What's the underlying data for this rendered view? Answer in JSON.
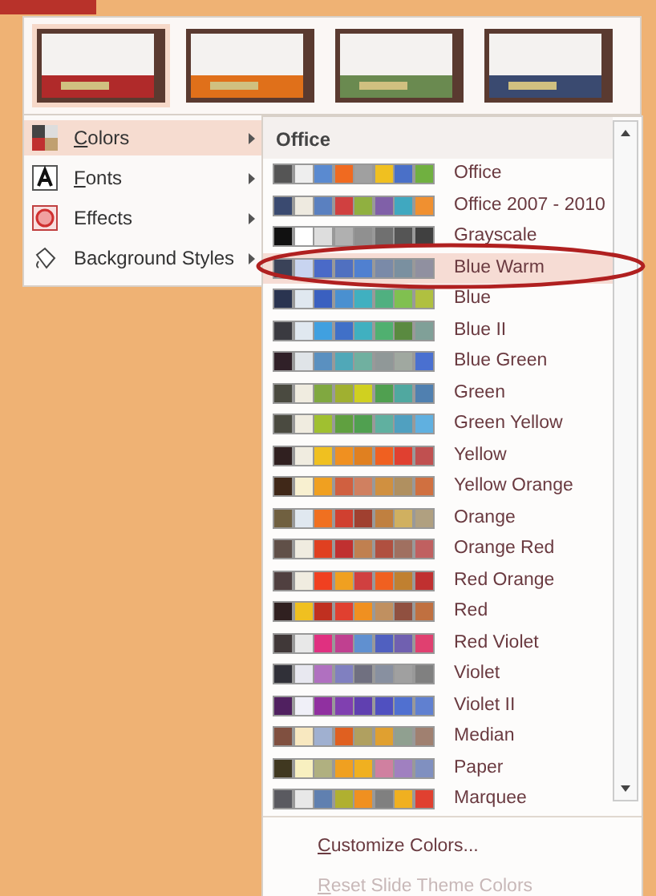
{
  "themes": [
    {
      "color": "#b02a2a",
      "selected": true
    },
    {
      "color": "#e0701a",
      "selected": false
    },
    {
      "color": "#6a8a50",
      "selected": false
    },
    {
      "color": "#3a4a70",
      "selected": false
    }
  ],
  "menu": [
    {
      "label": "Colors",
      "mnemonic": true,
      "selected": true,
      "kind": "colors"
    },
    {
      "label": "Fonts",
      "mnemonic": true,
      "selected": false,
      "kind": "fonts"
    },
    {
      "label": "Effects",
      "mnemonic": false,
      "selected": false,
      "kind": "effects"
    },
    {
      "label": "Background Styles",
      "mnemonic": false,
      "selected": false,
      "kind": "background"
    }
  ],
  "submenu": {
    "header": "Office",
    "items": [
      {
        "label": "Office",
        "selected": false,
        "swatches": [
          {
            "color": "#555555"
          },
          {
            "color": "#eeeeee"
          },
          {
            "color": "#5a8ad0"
          },
          {
            "color": "#f06a20"
          },
          {
            "color": "#a0a0a0"
          },
          {
            "color": "#f0c020"
          },
          {
            "color": "#4a70c8"
          },
          {
            "color": "#70b040"
          }
        ]
      },
      {
        "label": "Office 2007 - 2010",
        "selected": false,
        "swatches": [
          {
            "color": "#3a4a70"
          },
          {
            "color": "#eeeae0"
          },
          {
            "color": "#5a80c0"
          },
          {
            "color": "#d04040"
          },
          {
            "color": "#90b040"
          },
          {
            "color": "#8060a8"
          },
          {
            "color": "#40a8c0"
          },
          {
            "color": "#f09030"
          }
        ]
      },
      {
        "label": "Grayscale",
        "selected": false,
        "swatches": [
          {
            "color": "#111111"
          },
          {
            "color": "#ffffff"
          },
          {
            "color": "#dddddd"
          },
          {
            "color": "#b0b0b0"
          },
          {
            "color": "#909090"
          },
          {
            "color": "#707070"
          },
          {
            "color": "#555555"
          },
          {
            "color": "#404040"
          }
        ]
      },
      {
        "label": "Blue Warm",
        "selected": true,
        "swatches": [
          {
            "color": "#3a4258"
          },
          {
            "color": "#c8d4f0"
          },
          {
            "color": "#4a6ac8"
          },
          {
            "color": "#5070c0"
          },
          {
            "color": "#5080d0"
          },
          {
            "color": "#7a8aa8"
          },
          {
            "color": "#7a90a0"
          },
          {
            "color": "#9090a0"
          }
        ]
      },
      {
        "label": "Blue",
        "selected": false,
        "swatches": [
          {
            "color": "#2a3450"
          },
          {
            "color": "#e0e8f0"
          },
          {
            "color": "#3a60c0"
          },
          {
            "color": "#4a90d0"
          },
          {
            "color": "#40b0c0"
          },
          {
            "color": "#50b080"
          },
          {
            "color": "#80c050"
          },
          {
            "color": "#b0c040"
          }
        ]
      },
      {
        "label": "Blue II",
        "selected": false,
        "swatches": [
          {
            "color": "#3a3a40"
          },
          {
            "color": "#e0e8f0"
          },
          {
            "color": "#40a0e0"
          },
          {
            "color": "#4070c8"
          },
          {
            "color": "#40b0c0"
          },
          {
            "color": "#50b070"
          },
          {
            "color": "#5a8a40"
          },
          {
            "color": "#80a098"
          }
        ]
      },
      {
        "label": "Blue Green",
        "selected": false,
        "swatches": [
          {
            "color": "#302028"
          },
          {
            "color": "#e0e4e8"
          },
          {
            "color": "#5a90c0"
          },
          {
            "color": "#50a8b8"
          },
          {
            "color": "#70b0a0"
          },
          {
            "color": "#909898"
          },
          {
            "color": "#a0a8a0"
          },
          {
            "color": "#4a70d0"
          }
        ]
      },
      {
        "label": "Green",
        "selected": false,
        "swatches": [
          {
            "color": "#4a4a40"
          },
          {
            "color": "#f0ece0"
          },
          {
            "color": "#80a840"
          },
          {
            "color": "#a0b030"
          },
          {
            "color": "#d0d020"
          },
          {
            "color": "#50a050"
          },
          {
            "color": "#50a8a0"
          },
          {
            "color": "#5080b0"
          }
        ]
      },
      {
        "label": "Green Yellow",
        "selected": false,
        "swatches": [
          {
            "color": "#4a4a40"
          },
          {
            "color": "#f0ece0"
          },
          {
            "color": "#a0c030"
          },
          {
            "color": "#60a040"
          },
          {
            "color": "#50a050"
          },
          {
            "color": "#60b0a0"
          },
          {
            "color": "#50a0c0"
          },
          {
            "color": "#60b0e0"
          }
        ]
      },
      {
        "label": "Yellow",
        "selected": false,
        "swatches": [
          {
            "color": "#302020"
          },
          {
            "color": "#f0ece0"
          },
          {
            "color": "#f0c020"
          },
          {
            "color": "#f09020"
          },
          {
            "color": "#e08020"
          },
          {
            "color": "#f06020"
          },
          {
            "color": "#e04030"
          },
          {
            "color": "#c05050"
          }
        ]
      },
      {
        "label": "Yellow Orange",
        "selected": false,
        "swatches": [
          {
            "color": "#402818"
          },
          {
            "color": "#f8f0d0"
          },
          {
            "color": "#f0a020"
          },
          {
            "color": "#d06040"
          },
          {
            "color": "#d08060"
          },
          {
            "color": "#d09040"
          },
          {
            "color": "#b09060"
          },
          {
            "color": "#d07040"
          }
        ]
      },
      {
        "label": "Orange",
        "selected": false,
        "swatches": [
          {
            "color": "#706040"
          },
          {
            "color": "#e0e8f0"
          },
          {
            "color": "#f07020"
          },
          {
            "color": "#d04030"
          },
          {
            "color": "#a04030"
          },
          {
            "color": "#c08040"
          },
          {
            "color": "#d0b060"
          },
          {
            "color": "#b0a080"
          }
        ]
      },
      {
        "label": "Orange Red",
        "selected": false,
        "swatches": [
          {
            "color": "#605048"
          },
          {
            "color": "#f0ece0"
          },
          {
            "color": "#e04020"
          },
          {
            "color": "#c03030"
          },
          {
            "color": "#c08050"
          },
          {
            "color": "#b05040"
          },
          {
            "color": "#a07060"
          },
          {
            "color": "#c06060"
          }
        ]
      },
      {
        "label": "Red Orange",
        "selected": false,
        "swatches": [
          {
            "color": "#504040"
          },
          {
            "color": "#f0ece0"
          },
          {
            "color": "#f04020"
          },
          {
            "color": "#f0a020"
          },
          {
            "color": "#d04040"
          },
          {
            "color": "#f06020"
          },
          {
            "color": "#c08030"
          },
          {
            "color": "#c03030"
          }
        ]
      },
      {
        "label": "Red",
        "selected": false,
        "swatches": [
          {
            "color": "#302020"
          },
          {
            "color": "#f0c020"
          },
          {
            "color": "#c03020"
          },
          {
            "color": "#e04030"
          },
          {
            "color": "#f09020"
          },
          {
            "color": "#c09060"
          },
          {
            "color": "#905040"
          },
          {
            "color": "#c07040"
          }
        ]
      },
      {
        "label": "Red Violet",
        "selected": false,
        "swatches": [
          {
            "color": "#403838"
          },
          {
            "color": "#e8e8e8"
          },
          {
            "color": "#e03080"
          },
          {
            "color": "#c04090"
          },
          {
            "color": "#6090d0"
          },
          {
            "color": "#5060c0"
          },
          {
            "color": "#7060b0"
          },
          {
            "color": "#e04070"
          }
        ]
      },
      {
        "label": "Violet",
        "selected": false,
        "swatches": [
          {
            "color": "#303038"
          },
          {
            "color": "#e8e8f0"
          },
          {
            "color": "#b070c0"
          },
          {
            "color": "#8080c0"
          },
          {
            "color": "#707080"
          },
          {
            "color": "#8890a0"
          },
          {
            "color": "#a0a0a0"
          },
          {
            "color": "#808080"
          }
        ]
      },
      {
        "label": "Violet II",
        "selected": false,
        "swatches": [
          {
            "color": "#502060"
          },
          {
            "color": "#f0f0f8"
          },
          {
            "color": "#9030a0"
          },
          {
            "color": "#8040b0"
          },
          {
            "color": "#6040b0"
          },
          {
            "color": "#5050c0"
          },
          {
            "color": "#5070d0"
          },
          {
            "color": "#6080d0"
          }
        ]
      },
      {
        "label": "Median",
        "selected": false,
        "swatches": [
          {
            "color": "#805040"
          },
          {
            "color": "#f8e8c0"
          },
          {
            "color": "#a0b0d0"
          },
          {
            "color": "#e06020"
          },
          {
            "color": "#b0a060"
          },
          {
            "color": "#e0a030"
          },
          {
            "color": "#90a090"
          },
          {
            "color": "#a08070"
          }
        ]
      },
      {
        "label": "Paper",
        "selected": false,
        "swatches": [
          {
            "color": "#403820"
          },
          {
            "color": "#f8f0c0"
          },
          {
            "color": "#b0b080"
          },
          {
            "color": "#f0a020"
          },
          {
            "color": "#f0b020"
          },
          {
            "color": "#d080a0"
          },
          {
            "color": "#a080c0"
          },
          {
            "color": "#8090c0"
          }
        ]
      },
      {
        "label": "Marquee",
        "selected": false,
        "swatches": [
          {
            "color": "#5a5a60"
          },
          {
            "color": "#e8e8e8"
          },
          {
            "color": "#6080b0"
          },
          {
            "color": "#b0b030"
          },
          {
            "color": "#f09020"
          },
          {
            "color": "#808080"
          },
          {
            "color": "#f0b020"
          },
          {
            "color": "#e04030"
          }
        ]
      }
    ]
  },
  "footer": [
    {
      "label": "Customize Colors...",
      "mnemonic": true,
      "disabled": false
    },
    {
      "label": "Reset Slide Theme Colors",
      "mnemonic": true,
      "disabled": true
    }
  ]
}
